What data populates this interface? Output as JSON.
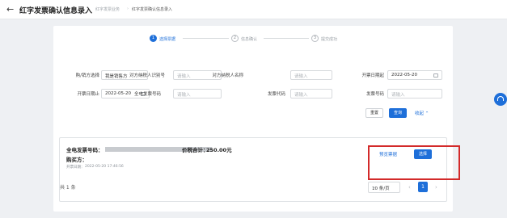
{
  "header": {
    "back_icon": "back-arrow-icon",
    "title": "红字发票确认信息录入",
    "breadcrumb": [
      "红字发票业务",
      "红字发票确认信息录入"
    ]
  },
  "steps": [
    {
      "num": "1",
      "label": "选择票据",
      "active": true
    },
    {
      "num": "2",
      "label": "信息确认",
      "active": false
    },
    {
      "num": "3",
      "label": "提交成功",
      "active": false
    }
  ],
  "filters": {
    "buyer_seller": {
      "label": "购/销方选择",
      "value": "我是销售方"
    },
    "counterparty_tax_id": {
      "label": "对方纳税人识别号",
      "placeholder": "请输入"
    },
    "counterparty_name": {
      "label": "对方纳税人名称",
      "placeholder": "请输入"
    },
    "date_start": {
      "label": "开票日期起",
      "value": "2022-05-20"
    },
    "date_end": {
      "label": "开票日期止",
      "value": "2022-05-20"
    },
    "full_invoice_no": {
      "label": "全电发票号码",
      "placeholder": "请输入"
    },
    "invoice_code": {
      "label": "发票代码",
      "placeholder": "请输入"
    },
    "invoice_no": {
      "label": "发票号码",
      "placeholder": "请输入"
    }
  },
  "actions": {
    "reset": "重置",
    "query": "查询",
    "collapse": "收起"
  },
  "result": {
    "invoice_no_label": "全电发票号码：",
    "total_label": "价税合计：",
    "total_value": "250.00元",
    "buyer_label": "购买方：",
    "issue_date_label": "开票日期：",
    "issue_date_value": "2022-05-20 17:46:56",
    "preview_link": "预览票据",
    "select_button": "选择"
  },
  "pagination": {
    "total_text": "共 1 条",
    "page_size": "10 条/页",
    "current_page": "1"
  },
  "colors": {
    "primary": "#1e6fd9",
    "highlight_border": "#d32a2a"
  }
}
